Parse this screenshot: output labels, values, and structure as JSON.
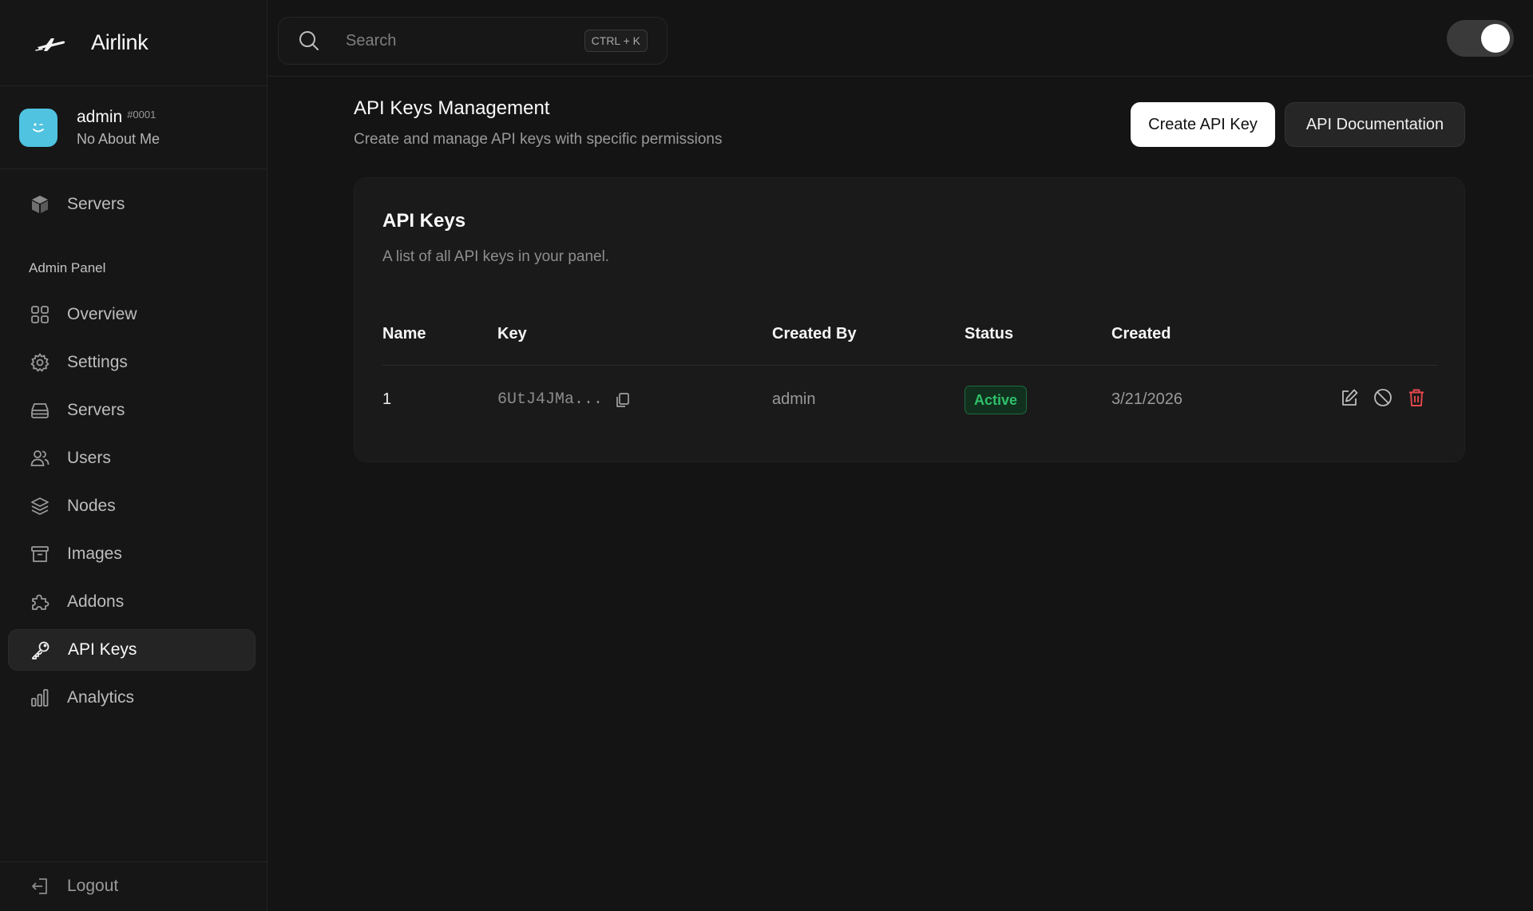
{
  "brand": {
    "name": "Airlink"
  },
  "profile": {
    "username": "admin",
    "tag": "#0001",
    "about": "No About Me"
  },
  "sidebar": {
    "top_items": [
      {
        "label": "Servers",
        "icon": "cube-icon"
      }
    ],
    "section_label": "Admin Panel",
    "items": [
      {
        "label": "Overview",
        "icon": "grid-icon"
      },
      {
        "label": "Settings",
        "icon": "gear-icon"
      },
      {
        "label": "Servers",
        "icon": "server-icon"
      },
      {
        "label": "Users",
        "icon": "users-icon"
      },
      {
        "label": "Nodes",
        "icon": "layers-icon"
      },
      {
        "label": "Images",
        "icon": "archive-icon"
      },
      {
        "label": "Addons",
        "icon": "puzzle-icon"
      },
      {
        "label": "API Keys",
        "icon": "key-icon",
        "active": true
      },
      {
        "label": "Analytics",
        "icon": "bar-chart-icon"
      }
    ],
    "footer": {
      "label": "Logout",
      "icon": "logout-icon"
    }
  },
  "search": {
    "placeholder": "Search",
    "shortcut": "CTRL + K"
  },
  "theme_toggle": {
    "state": "on"
  },
  "page": {
    "title": "API Keys Management",
    "subtitle": "Create and manage API keys with specific permissions",
    "create_button": "Create API Key",
    "docs_button": "API Documentation"
  },
  "card": {
    "title": "API Keys",
    "subtitle": "A list of all API keys in your panel.",
    "columns": [
      "Name",
      "Key",
      "Created By",
      "Status",
      "Created"
    ],
    "rows": [
      {
        "name": "1",
        "key": "6UtJ4JMa...",
        "created_by": "admin",
        "status": "Active",
        "created": "3/21/2026"
      }
    ]
  },
  "colors": {
    "background": "#141414",
    "accent_status": "#2ec16a",
    "danger": "#e5484d",
    "avatar": "#4fc3e0"
  }
}
